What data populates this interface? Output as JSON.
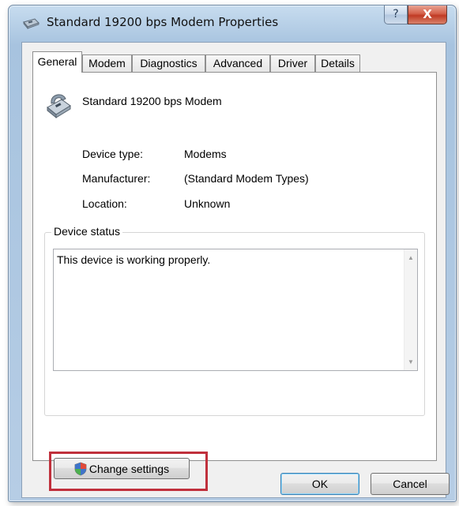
{
  "window": {
    "title": "Standard 19200 bps Modem Properties",
    "help_label": "?",
    "close_label": "X"
  },
  "tabs": [
    {
      "label": "General",
      "active": true
    },
    {
      "label": "Modem",
      "active": false
    },
    {
      "label": "Diagnostics",
      "active": false
    },
    {
      "label": "Advanced",
      "active": false
    },
    {
      "label": "Driver",
      "active": false
    },
    {
      "label": "Details",
      "active": false
    }
  ],
  "general": {
    "device_name": "Standard 19200 bps Modem",
    "properties": [
      {
        "label": "Device type:",
        "value": "Modems"
      },
      {
        "label": "Manufacturer:",
        "value": "(Standard Modem Types)"
      },
      {
        "label": "Location:",
        "value": "Unknown"
      }
    ],
    "status_group_title": "Device status",
    "status_text": "This device is working properly.",
    "change_settings_label": "Change settings"
  },
  "footer": {
    "ok_label": "OK",
    "cancel_label": "Cancel"
  },
  "colors": {
    "highlight": "#c0303c",
    "close_button": "#c03a24"
  },
  "icons": [
    "modem-title-icon",
    "modem-device-icon",
    "uac-shield-icon",
    "help-icon",
    "close-icon",
    "scroll-up-icon",
    "scroll-down-icon"
  ]
}
